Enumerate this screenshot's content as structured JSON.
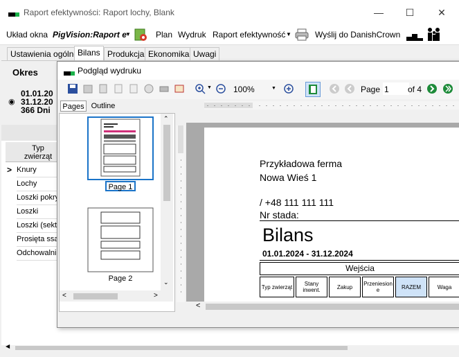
{
  "window": {
    "title": "Raport efektywności: Raport lochy, Blank"
  },
  "toolbar": {
    "layout_label": "Układ okna",
    "layout_value": "PigVision:Raport e",
    "plan_label": "Plan",
    "print_label": "Wydruk",
    "print_value": "Raport efektywność",
    "send_label": "Wyślij do DanishCrown"
  },
  "tabs": [
    "Ustawienia ogólne",
    "Bilans",
    "Produkcja",
    "Ekonomika",
    "Uwagi"
  ],
  "period": {
    "label": "Okres",
    "from": "01.01.20",
    "to": "31.12.20",
    "days": "366 Dni"
  },
  "grid": {
    "header": "Typ zwierząt",
    "rows": [
      "Knury",
      "Lochy",
      "Loszki pokry",
      "Loszki",
      "Loszki (sekt",
      "Prosięta ssą",
      "Odchowalni"
    ]
  },
  "preview": {
    "title": "Podgląd wydruku",
    "zoom": "100%",
    "page_label": "Page",
    "page_value": "1",
    "of_label": "of 4",
    "tabs": [
      "Pages",
      "Outline"
    ],
    "thumbs": [
      "Page 1",
      "Page 2"
    ],
    "document": {
      "farm_name": "Przykładowa ferma",
      "farm_address": "Nowa Wieś 1",
      "phone": "/ +48 111 111 111",
      "herd_label": "Nr stada:",
      "heading": "Bilans",
      "date_range": "01.01.2024 - 31.12.2024",
      "section": "Wejścia",
      "columns": [
        "Typ zwierząt",
        "Stany inwent.",
        "Zakup",
        "Przeniesion e",
        "RAZEM",
        "Waga"
      ]
    }
  }
}
